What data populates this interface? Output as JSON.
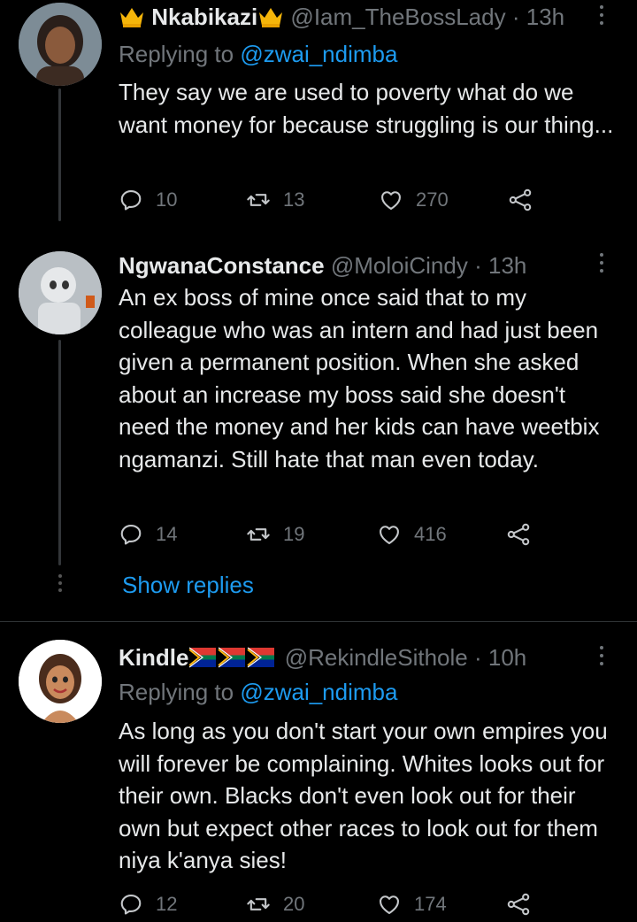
{
  "tweets": [
    {
      "name": "Nkabikazi",
      "handle": "@Iam_TheBossLady",
      "dot": "·",
      "time": "13h",
      "replying_label": "Replying to",
      "replying_to": "@zwai_ndimba",
      "text": "They say we are used to poverty what do we want money for because struggling is our thing...",
      "replies": "10",
      "retweets": "13",
      "likes": "270"
    },
    {
      "name": "NgwanaConstance",
      "handle": "@MoloiCindy",
      "dot": "·",
      "time": "13h",
      "text": "An ex boss of mine once said that to my colleague who was an intern and had just been given a permanent position. When she asked about an increase my boss said she doesn't need the money and her kids can have weetbix ngamanzi. Still hate that man even today.",
      "replies": "14",
      "retweets": "19",
      "likes": "416",
      "show_replies": "Show replies"
    },
    {
      "name": "Kindle",
      "handle": "@RekindleSithole",
      "dot": "·",
      "time": "10h",
      "replying_label": "Replying to",
      "replying_to": "@zwai_ndimba",
      "text": "As long as you don't start your own empires you will forever be complaining. Whites looks out for their own. Blacks don't even look out for their own but expect other races to look out for them niya k'anya sies!",
      "replies": "12",
      "retweets": "20",
      "likes": "174"
    }
  ],
  "icons": {
    "reply": "reply-icon",
    "retweet": "retweet-icon",
    "like": "heart-icon",
    "share": "share-icon",
    "more": "more-icon",
    "emoji_name1": "crown-emoji",
    "emoji_name3": "south-africa-flag-emoji"
  },
  "colors": {
    "background": "#000000",
    "text": "#e7e9ea",
    "muted": "#71767b",
    "link": "#1d9bf0",
    "separator": "#2f3336"
  }
}
